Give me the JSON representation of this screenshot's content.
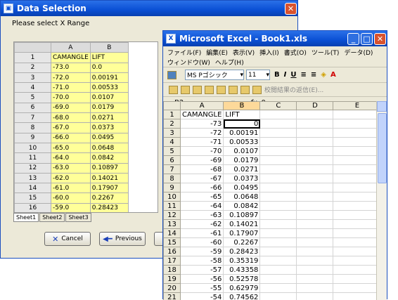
{
  "dialog": {
    "title": "Data Selection",
    "prompt": "Please select X Range",
    "columns": [
      "A",
      "B"
    ],
    "rows": [
      {
        "n": "1",
        "a": "CAMANGLE",
        "b": "LIFT"
      },
      {
        "n": "2",
        "a": "-73.0",
        "b": "0.0"
      },
      {
        "n": "3",
        "a": "-72.0",
        "b": "0.00191"
      },
      {
        "n": "4",
        "a": "-71.0",
        "b": "0.00533"
      },
      {
        "n": "5",
        "a": "-70.0",
        "b": "0.0107"
      },
      {
        "n": "6",
        "a": "-69.0",
        "b": "0.0179"
      },
      {
        "n": "7",
        "a": "-68.0",
        "b": "0.0271"
      },
      {
        "n": "8",
        "a": "-67.0",
        "b": "0.0373"
      },
      {
        "n": "9",
        "a": "-66.0",
        "b": "0.0495"
      },
      {
        "n": "10",
        "a": "-65.0",
        "b": "0.0648"
      },
      {
        "n": "11",
        "a": "-64.0",
        "b": "0.0842"
      },
      {
        "n": "12",
        "a": "-63.0",
        "b": "0.10897"
      },
      {
        "n": "13",
        "a": "-62.0",
        "b": "0.14021"
      },
      {
        "n": "14",
        "a": "-61.0",
        "b": "0.17907"
      },
      {
        "n": "15",
        "a": "-60.0",
        "b": "0.2267"
      },
      {
        "n": "16",
        "a": "-59.0",
        "b": "0.28423"
      }
    ],
    "sheet_tabs": [
      "Sheet1",
      "Sheet2",
      "Sheet3"
    ],
    "cancel_label": "Cancel",
    "previous_label": "Previous"
  },
  "excel": {
    "title": "Microsoft Excel - Book1.xls",
    "menu_row1": [
      "ファイル(F)",
      "編集(E)",
      "表示(V)",
      "挿入(I)",
      "書式(O)",
      "ツール(T)",
      "データ(D)"
    ],
    "menu_row2": [
      "ウィンドウ(W)",
      "ヘルプ(H)"
    ],
    "font_name": "MS Pゴシック",
    "font_size": "11",
    "review_label": "校閲結果の返信(E)...",
    "name_box": "B2",
    "fx_label": "fx",
    "formula_value": "0",
    "columns": [
      "A",
      "B",
      "C",
      "D",
      "E"
    ],
    "rows": [
      {
        "n": "1",
        "a": "CAMANGLE",
        "b": "LIFT"
      },
      {
        "n": "2",
        "a": "-73",
        "b": "0"
      },
      {
        "n": "3",
        "a": "-72",
        "b": "0.00191"
      },
      {
        "n": "4",
        "a": "-71",
        "b": "0.00533"
      },
      {
        "n": "5",
        "a": "-70",
        "b": "0.0107"
      },
      {
        "n": "6",
        "a": "-69",
        "b": "0.0179"
      },
      {
        "n": "7",
        "a": "-68",
        "b": "0.0271"
      },
      {
        "n": "8",
        "a": "-67",
        "b": "0.0373"
      },
      {
        "n": "9",
        "a": "-66",
        "b": "0.0495"
      },
      {
        "n": "10",
        "a": "-65",
        "b": "0.0648"
      },
      {
        "n": "11",
        "a": "-64",
        "b": "0.0842"
      },
      {
        "n": "12",
        "a": "-63",
        "b": "0.10897"
      },
      {
        "n": "13",
        "a": "-62",
        "b": "0.14021"
      },
      {
        "n": "14",
        "a": "-61",
        "b": "0.17907"
      },
      {
        "n": "15",
        "a": "-60",
        "b": "0.2267"
      },
      {
        "n": "16",
        "a": "-59",
        "b": "0.28423"
      },
      {
        "n": "17",
        "a": "-58",
        "b": "0.35319"
      },
      {
        "n": "18",
        "a": "-57",
        "b": "0.43358"
      },
      {
        "n": "19",
        "a": "-56",
        "b": "0.52578"
      },
      {
        "n": "20",
        "a": "-55",
        "b": "0.62979"
      },
      {
        "n": "21",
        "a": "-54",
        "b": "0.74562"
      }
    ]
  }
}
